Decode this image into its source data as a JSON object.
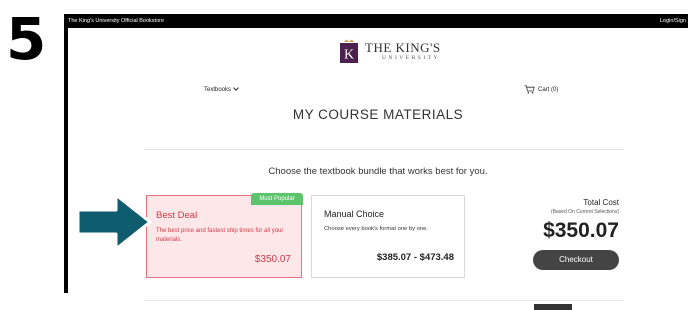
{
  "step": {
    "number": "5"
  },
  "browser": {
    "topbar": {
      "left_text": "The King's University Official Bookstore",
      "right_text": "Login/Sign"
    }
  },
  "header": {
    "logo_letter": "K",
    "logo_name": "THE KING'S",
    "logo_sub": "UNIVERSITY",
    "nav_textbooks": "Textbooks",
    "cart_label": "Cart (0)"
  },
  "main": {
    "title": "MY COURSE MATERIALS",
    "subtitle": "Choose the textbook bundle that works best for you.",
    "options": [
      {
        "badge": "Most Popular",
        "title": "Best Deal",
        "description": "The best price and fastest ship times for all your materials.",
        "price": "$350.07"
      },
      {
        "title": "Manual Choice",
        "description": "Choose every book's format one by one.",
        "price": "$385.07 - $473.48"
      }
    ],
    "total": {
      "label": "Total Cost",
      "note": "(Based On Current Selections)",
      "amount": "$350.07",
      "checkout_label": "Checkout"
    }
  },
  "colors": {
    "accent_red": "#d13a47",
    "badge_green": "#5cc46b",
    "arrow_teal": "#0e5c6e",
    "logo_purple": "#4b1f4e"
  }
}
